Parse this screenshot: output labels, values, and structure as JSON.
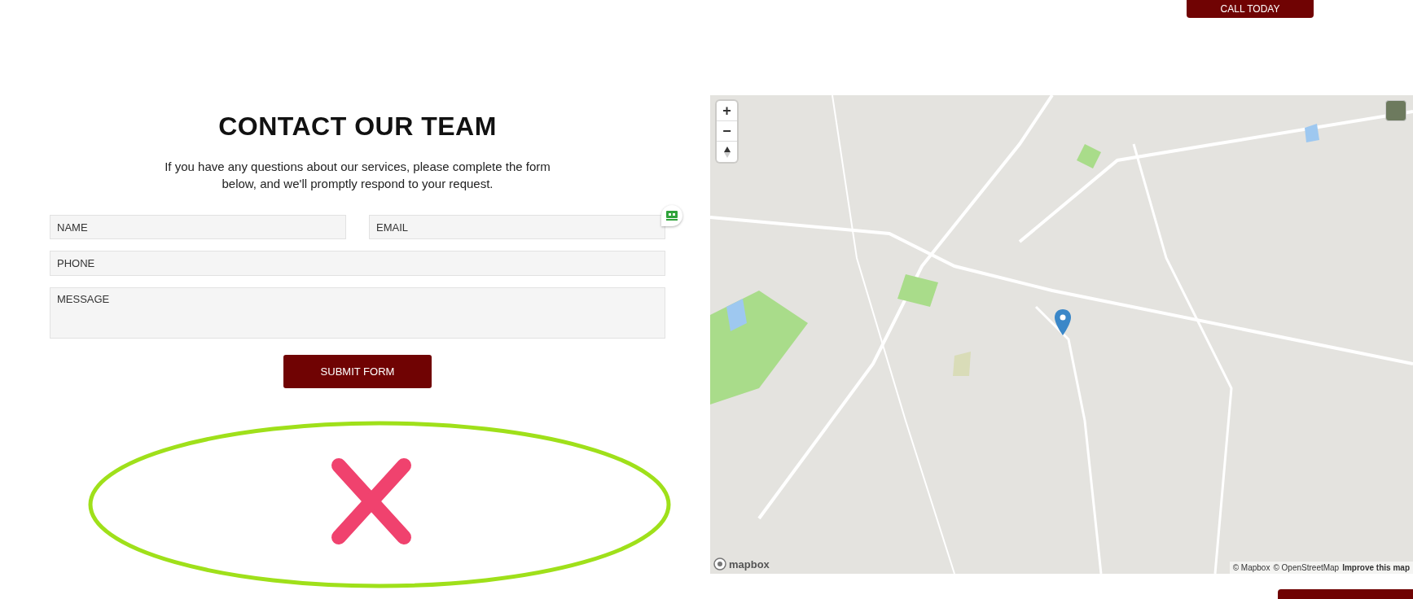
{
  "header": {
    "call_button": "CALL TODAY"
  },
  "contact": {
    "title": "CONTACT OUR TEAM",
    "intro": "If you have any questions about our services, please complete the form below, and we'll promptly respond to your request.",
    "fields": [
      {
        "placeholder": "NAME",
        "kind": "half"
      },
      {
        "placeholder": "EMAIL",
        "kind": "half"
      },
      {
        "placeholder": "PHONE",
        "kind": "full"
      },
      {
        "placeholder": "MESSAGE",
        "kind": "area"
      }
    ],
    "submit": "SUBMIT FORM"
  },
  "map": {
    "zoom_in": "+",
    "zoom_out": "−",
    "logo": "mapbox",
    "attribution": [
      "© Mapbox",
      "© OpenStreetMap"
    ],
    "improve_link": "Improve this map"
  }
}
